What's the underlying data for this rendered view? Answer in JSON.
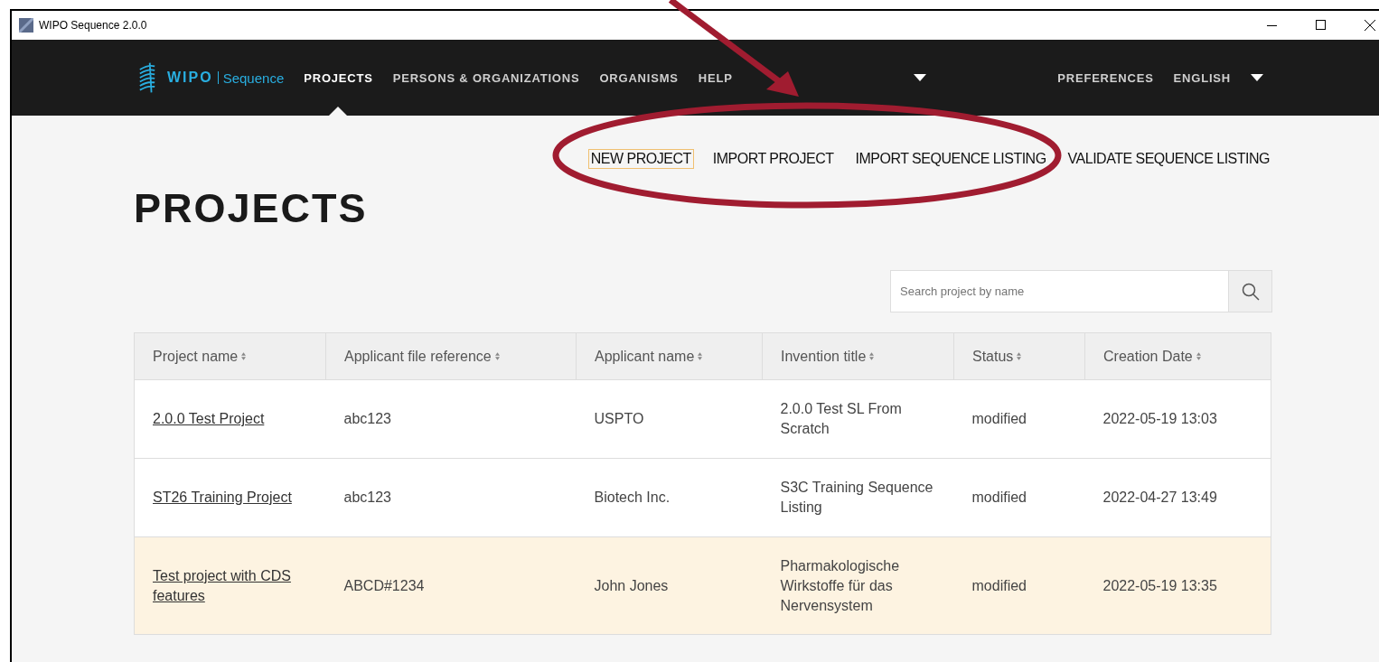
{
  "window": {
    "title": "WIPO Sequence 2.0.0"
  },
  "logo": {
    "brand": "WIPO",
    "product": "Sequence"
  },
  "nav": {
    "items": [
      {
        "label": "PROJECTS",
        "selected": true
      },
      {
        "label": "PERSONS & ORGANIZATIONS",
        "selected": false
      },
      {
        "label": "ORGANISMS",
        "selected": false
      },
      {
        "label": "HELP",
        "selected": false
      }
    ],
    "right": [
      {
        "label": "PREFERENCES"
      },
      {
        "label": "ENGLISH"
      }
    ]
  },
  "actions": [
    {
      "label": "NEW PROJECT",
      "focused": true
    },
    {
      "label": "IMPORT PROJECT",
      "focused": false
    },
    {
      "label": "IMPORT SEQUENCE LISTING",
      "focused": false
    },
    {
      "label": "VALIDATE SEQUENCE LISTING",
      "focused": false
    }
  ],
  "heading": "PROJECTS",
  "search": {
    "placeholder": "Search project by name"
  },
  "table": {
    "columns": [
      "Project name",
      "Applicant file reference",
      "Applicant name",
      "Invention title",
      "Status",
      "Creation Date"
    ],
    "rows": [
      {
        "selected": false,
        "cells": [
          "2.0.0 Test Project",
          "abc123",
          "USPTO",
          "2.0.0 Test SL From Scratch",
          "modified",
          "2022-05-19 13:03"
        ]
      },
      {
        "selected": false,
        "cells": [
          "ST26 Training Project",
          "abc123",
          "Biotech Inc.",
          "S3C Training Sequence Listing",
          "modified",
          "2022-04-27 13:49"
        ]
      },
      {
        "selected": true,
        "cells": [
          "Test project with CDS features",
          "ABCD#1234",
          "John Jones",
          "Pharmakologische Wirkstoffe für das Nervensystem",
          "modified",
          "2022-05-19 13:35"
        ]
      }
    ]
  }
}
